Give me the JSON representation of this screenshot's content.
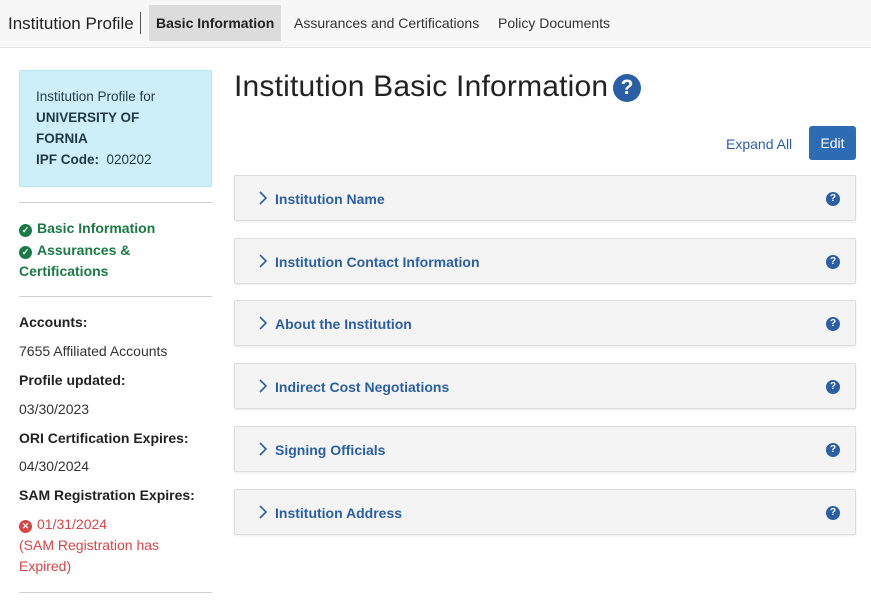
{
  "nav": {
    "brand": "Institution Profile",
    "tabs": [
      {
        "label": "Basic Information",
        "active": true
      },
      {
        "label": "Assurances and Certifications",
        "active": false
      },
      {
        "label": "Policy Documents",
        "active": false
      }
    ]
  },
  "profile": {
    "for_label": "Institution Profile for",
    "name_line1": "UNIVERSITY OF",
    "name_line2": "FORNIA",
    "ipf_label": "IPF Code:",
    "ipf_code": "020202"
  },
  "status": {
    "basic": "Basic Information",
    "assurances_line1": "Assurances &",
    "assurances_line2": "Certifications"
  },
  "info": {
    "accounts_label": "Accounts:",
    "accounts_value": "7655 Affiliated Accounts",
    "profile_updated_label": "Profile updated:",
    "profile_updated_value": "03/30/2023",
    "ori_label": "ORI Certification Expires:",
    "ori_value": "04/30/2024",
    "sam_label": "SAM Registration Expires:",
    "sam_date": "01/31/2024",
    "sam_note_line1": "(SAM Registration has",
    "sam_note_line2": "Expired)"
  },
  "main": {
    "title": "Institution Basic Information",
    "expand_all": "Expand All",
    "edit": "Edit",
    "sections": [
      "Institution Name",
      "Institution Contact Information",
      "About the Institution",
      "Indirect Cost Negotiations",
      "Signing Officials",
      "Institution Address"
    ]
  },
  "colors": {
    "accent": "#2b5fa5",
    "success": "#1a7a45",
    "danger": "#d64545",
    "info_bg": "#cdeffa"
  }
}
